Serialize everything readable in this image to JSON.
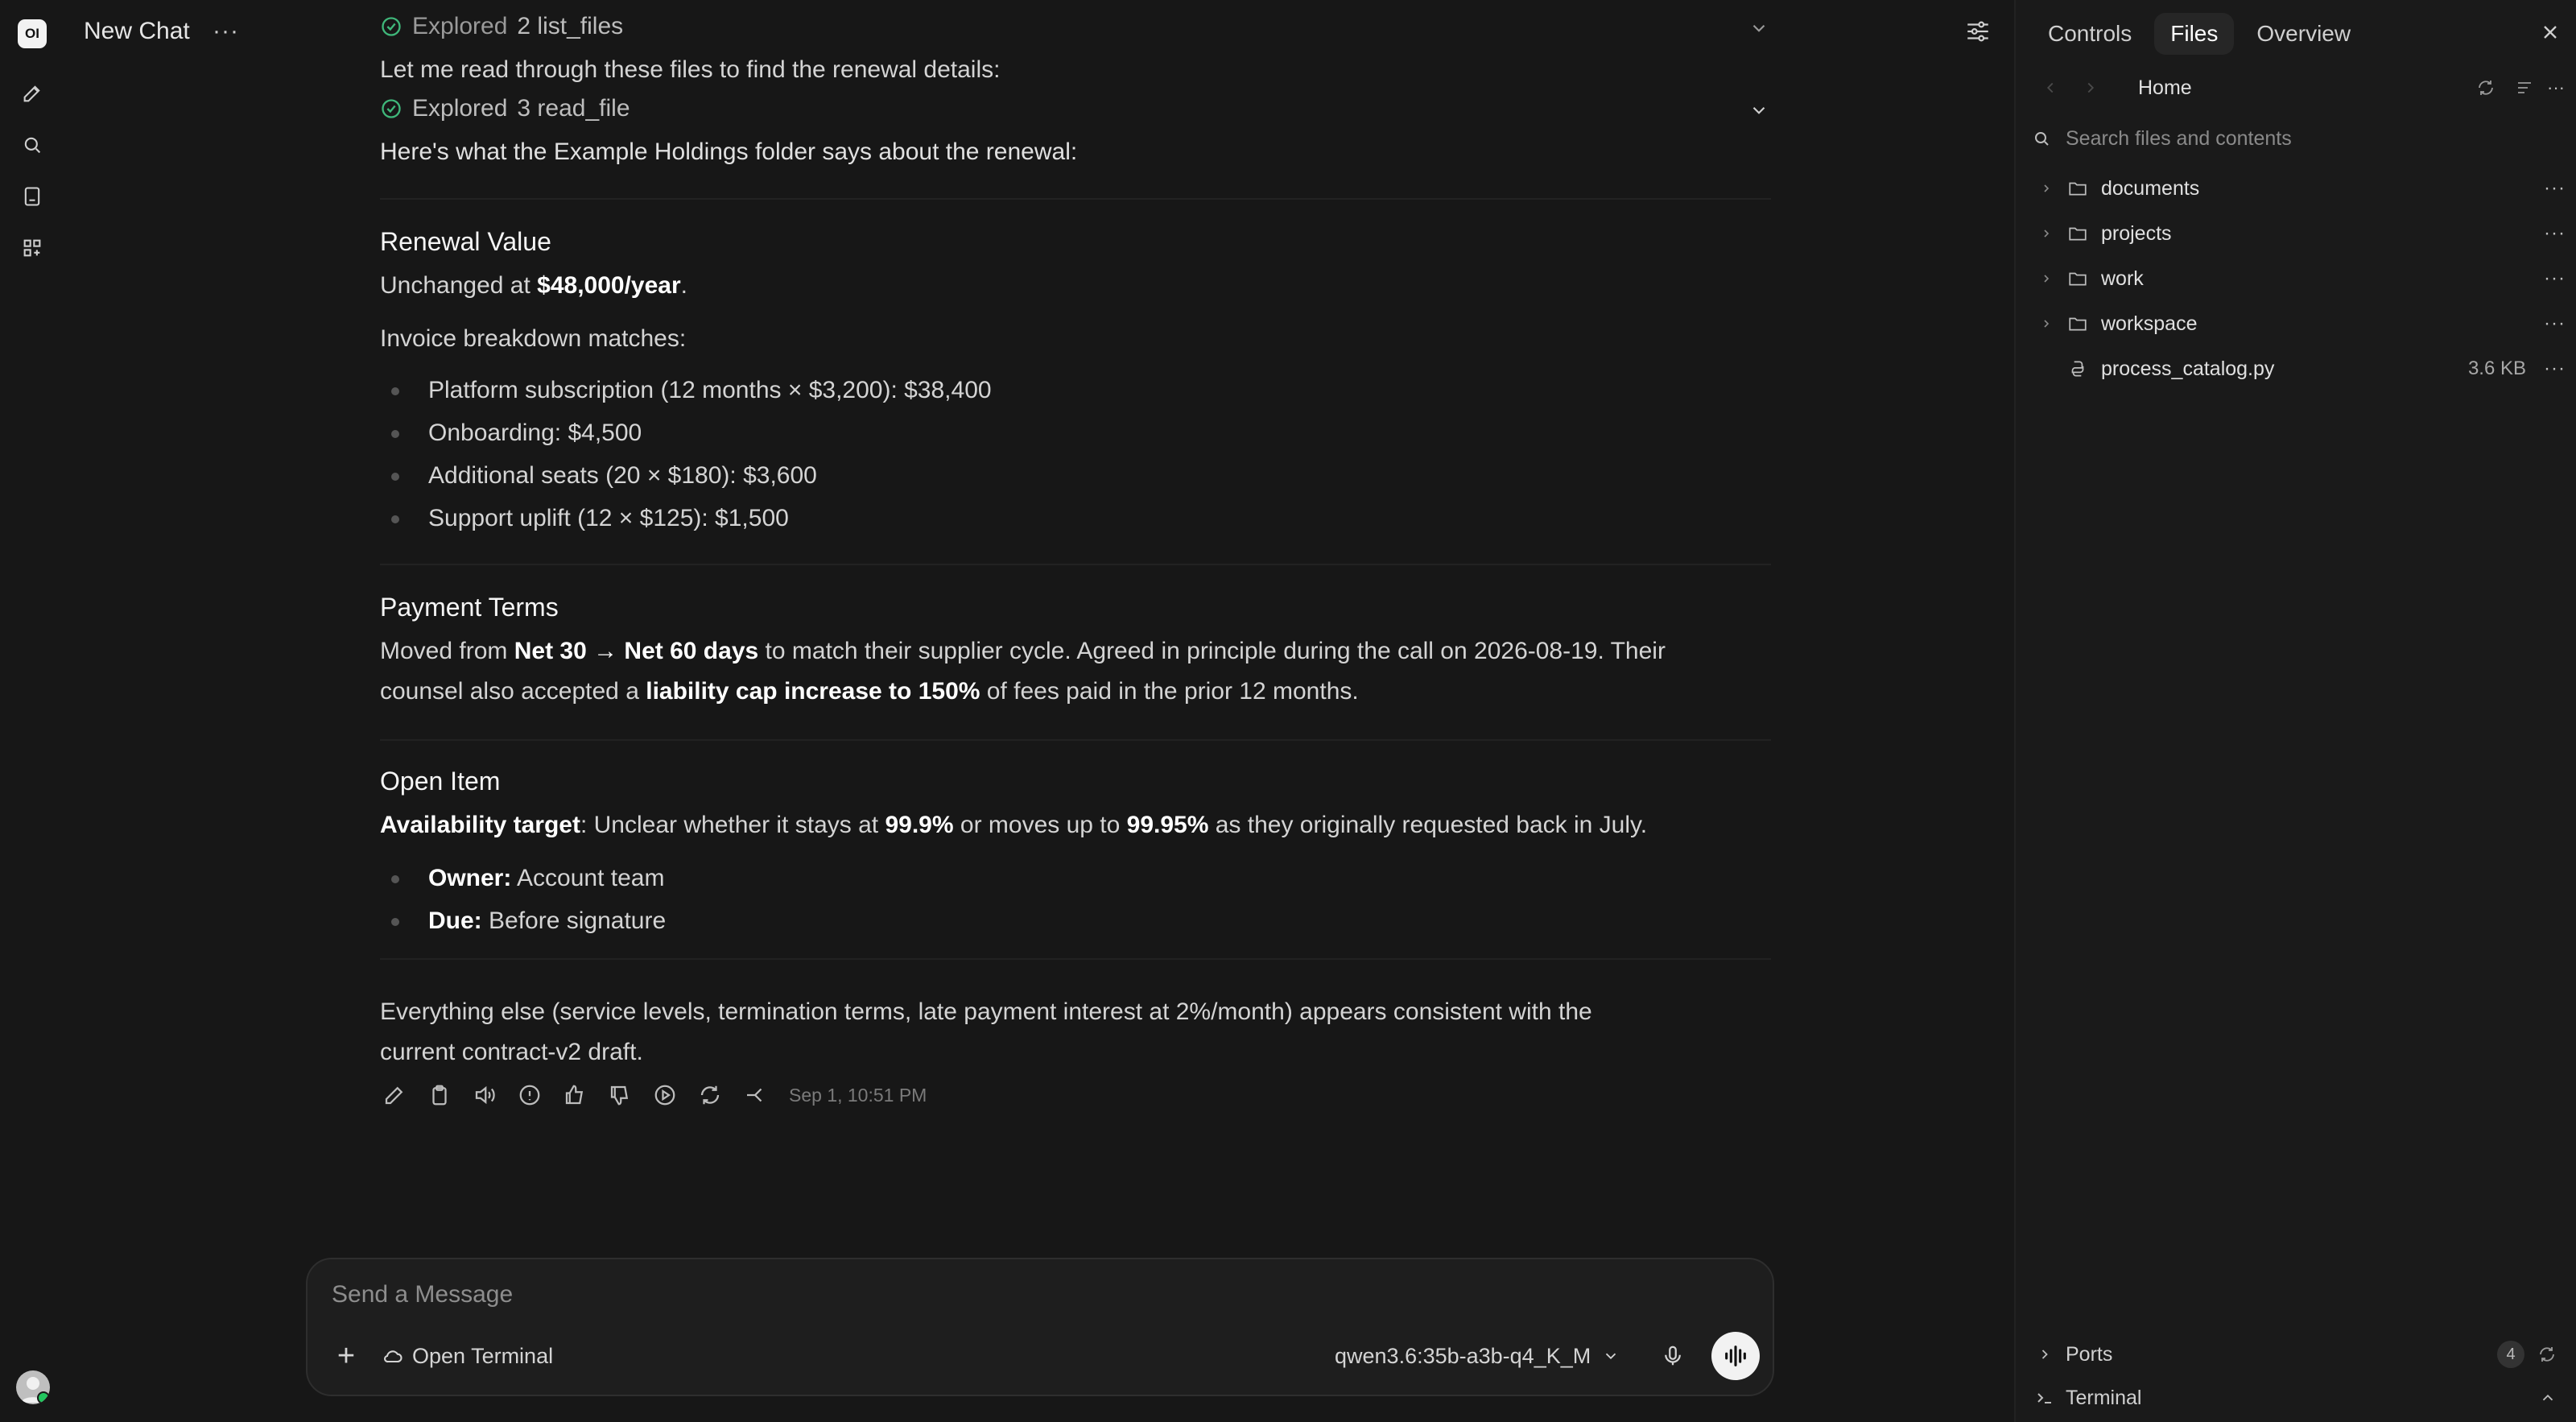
{
  "app": {
    "logo_text": "OI"
  },
  "header": {
    "title": "New Chat",
    "more": "···"
  },
  "message": {
    "explored_1": {
      "prefix": "Explored",
      "detail": "2 list_files"
    },
    "read_through": "Let me read through these files to find the renewal details:",
    "explored_2": {
      "prefix": "Explored",
      "detail": "3 read_file"
    },
    "intro": "Here's what the Example Holdings folder says about the renewal:",
    "renewal": {
      "heading": "Renewal Value",
      "line_pre": "Unchanged at ",
      "line_strong": "$48,000/year",
      "line_post": ".",
      "breakdown_label": "Invoice breakdown matches:",
      "items": [
        "Platform subscription (12 months × $3,200): $38,400",
        "Onboarding: $4,500",
        "Additional seats (20 × $180): $3,600",
        "Support uplift (12 × $125): $1,500"
      ]
    },
    "payment": {
      "heading": "Payment Terms",
      "t1": "Moved from ",
      "s1": "Net 30 → Net 60 days",
      "t2": " to match their supplier cycle. Agreed in principle during the call on 2026-08-19. Their",
      "t3": "counsel also accepted a ",
      "s2": "liability cap increase to 150%",
      "t4": " of fees paid in the prior 12 months."
    },
    "open_item": {
      "heading": "Open Item",
      "s1": "Availability target",
      "t1": ": Unclear whether it stays at ",
      "s2": "99.9%",
      "t2": " or moves up to ",
      "s3": "99.95%",
      "t3": " as they originally requested back in July.",
      "owner_label": "Owner:",
      "owner_value": " Account team",
      "due_label": "Due:",
      "due_value": " Before signature"
    },
    "closing_1": "Everything else (service levels, termination terms, late payment interest at 2%/month) appears consistent with the",
    "closing_2": "current contract-v2 draft.",
    "timestamp": "Sep 1, 10:51 PM"
  },
  "composer": {
    "placeholder": "Send a Message",
    "open_terminal": "Open Terminal",
    "model": "qwen3.6:35b-a3b-q4_K_M"
  },
  "panel": {
    "tabs": [
      "Controls",
      "Files",
      "Overview"
    ],
    "active_tab": "Files",
    "breadcrumb": "Home",
    "search_placeholder": "Search files and contents",
    "items": [
      {
        "name": "documents",
        "type": "folder"
      },
      {
        "name": "projects",
        "type": "folder"
      },
      {
        "name": "work",
        "type": "folder"
      },
      {
        "name": "workspace",
        "type": "folder"
      },
      {
        "name": "process_catalog.py",
        "type": "file",
        "size": "3.6 KB"
      }
    ],
    "ports_label": "Ports",
    "ports_count": "4",
    "terminal_label": "Terminal"
  },
  "colors": {
    "background": "#171717",
    "panel": "#1a1a1a",
    "accent_check": "#3fb77a",
    "online": "#22c55e"
  }
}
